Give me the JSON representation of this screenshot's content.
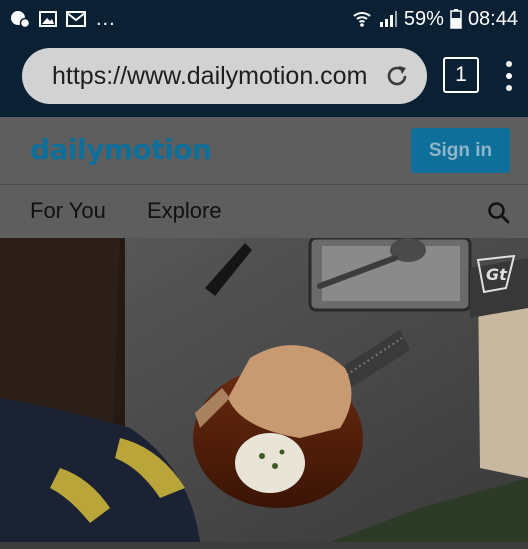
{
  "status_bar": {
    "left_icons": [
      "chat-notification-icon",
      "image-notification-icon",
      "email-notification-icon"
    ],
    "overflow": "...",
    "wifi_icon": "wifi-icon",
    "signal_icon": "signal-icon",
    "battery_percent": "59%",
    "battery_icon": "battery-icon",
    "time": "08:44"
  },
  "browser": {
    "url": "https://www.dailymotion.com",
    "reload_icon": "reload-icon",
    "tab_count": "1",
    "menu_icon": "more-vert-icon"
  },
  "site": {
    "logo": "dailymotion",
    "signin_label": "Sign in",
    "nav": {
      "tabs": [
        {
          "label": "For You"
        },
        {
          "label": "Explore"
        }
      ],
      "search_icon": "search-icon"
    },
    "video": {
      "thumbnail": "video-thumbnail",
      "watermark_icon": "channel-watermark-icon"
    }
  },
  "colors": {
    "status_bar_bg": "#0b2133",
    "accent": "#0e6f9a",
    "header_bg": "#5e5e5e"
  }
}
